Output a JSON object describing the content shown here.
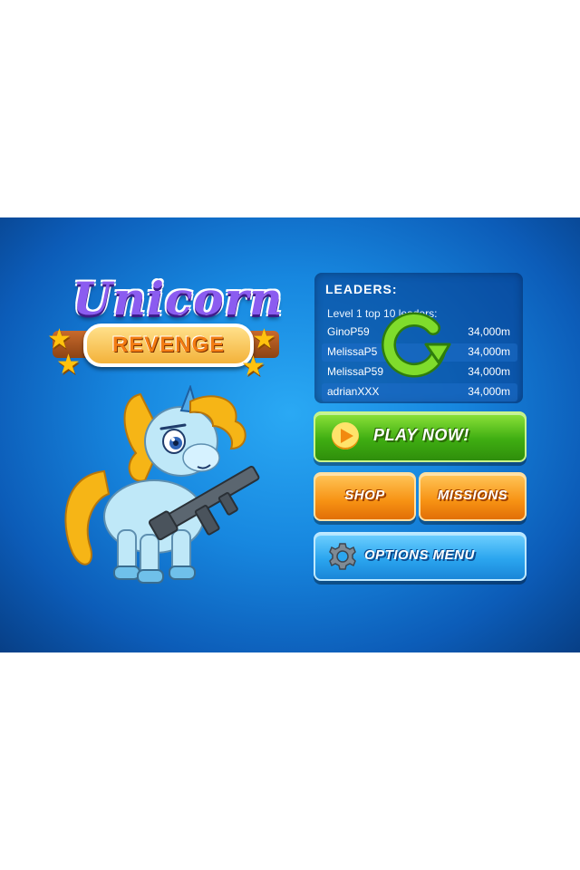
{
  "game": {
    "logo": {
      "title": "Unicorn",
      "subtitle": "REVENGE"
    },
    "leaders": {
      "title": "LEADERS:",
      "subtitle": "Level 1 top 10 leaders:",
      "rows": [
        {
          "name": "GinoP59",
          "score": "34,000m"
        },
        {
          "name": "MelissaP5",
          "score": "34,000m"
        },
        {
          "name": "MelissaP59",
          "score": "34,000m"
        },
        {
          "name": "adrianXXX",
          "score": "34,000m"
        }
      ]
    },
    "buttons": {
      "play": "PLAY NOW!",
      "shop": "SHOP",
      "missions": "MISSIONS",
      "options": "OPTIONS MENU"
    },
    "icons": {
      "refresh": "refresh-icon",
      "play": "play-icon",
      "options": "gear-icon",
      "stars": "star-icon"
    },
    "colors": {
      "background": "#1787df",
      "play_button": "#3fae12",
      "orange_button": "#f79213",
      "options_button": "#2ba6ef",
      "logo_purple": "#8b5cf0",
      "refresh_green": "#6ed12a"
    }
  }
}
